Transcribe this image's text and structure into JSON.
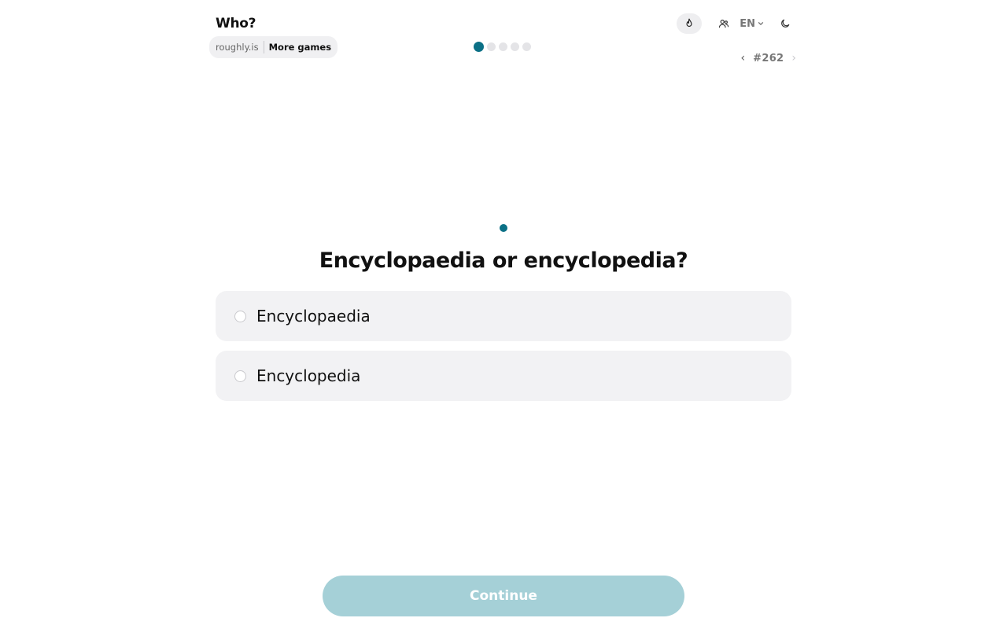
{
  "header": {
    "title": "Who?",
    "language": "EN",
    "site_name": "roughly.is",
    "more_games": "More games",
    "puzzle_number": "#262",
    "prev_arrow": "‹",
    "next_arrow": "›"
  },
  "progress": {
    "total_steps": 5,
    "current_step": 1
  },
  "question": {
    "text": "Encyclopaedia or encyclopedia?",
    "options": [
      {
        "label": "Encyclopaedia",
        "selected": false
      },
      {
        "label": "Encyclopedia",
        "selected": false
      }
    ]
  },
  "footer": {
    "continue_label": "Continue",
    "continue_enabled": false
  },
  "icons": {
    "streak": "flame-icon",
    "players": "users-icon",
    "language": "chevron-down-icon",
    "theme": "moon-icon"
  },
  "colors": {
    "accent": "#0b7086",
    "continue_disabled": "#a5d0d7",
    "option_background": "#f2f2f4"
  }
}
